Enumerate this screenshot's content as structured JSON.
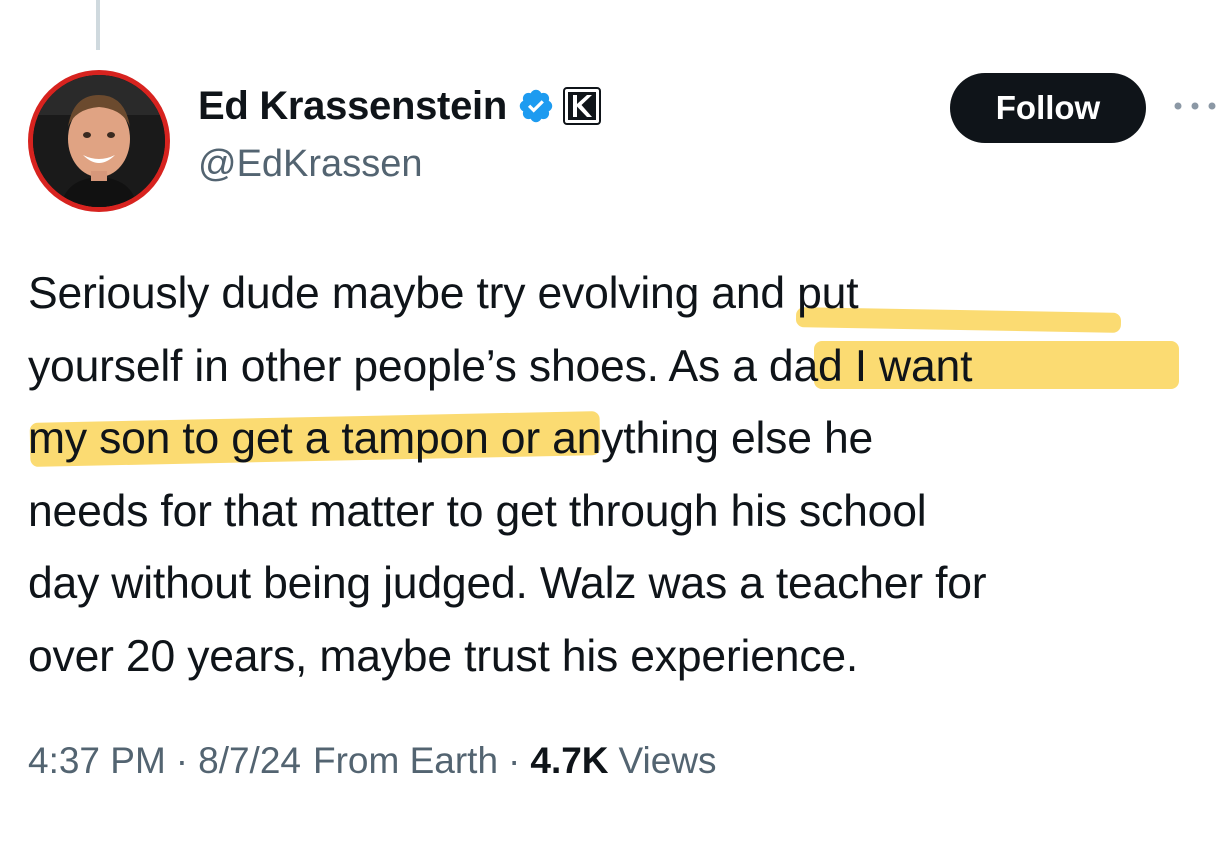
{
  "author": {
    "display_name": "Ed Krassenstein",
    "handle": "@EdKrassen",
    "verified_icon": "verified-badge-icon",
    "affiliate_icon": "k-affiliate-icon",
    "avatar_ring_color": "#d7231f"
  },
  "actions": {
    "follow_label": "Follow",
    "more_icon": "more-dots-icon"
  },
  "tweet": {
    "lines": [
      "Seriously dude maybe try evolving and put",
      "yourself in other people’s shoes. ",
      "As a dad I want",
      "my son to get a tampon",
      " or anything else he",
      "needs for that matter to get through his school",
      "day without being judged. Walz was a teacher for",
      "over 20 years, maybe trust his experience."
    ],
    "highlight_color": "#facd3c"
  },
  "meta": {
    "time": "4:37 PM",
    "date": "8/7/24",
    "source": "From Earth",
    "separator": "·",
    "views_count": "4.7K",
    "views_label": "Views"
  },
  "colors": {
    "text": "#0f1419",
    "secondary": "#536471",
    "verified_blue": "#1d9bf0"
  }
}
